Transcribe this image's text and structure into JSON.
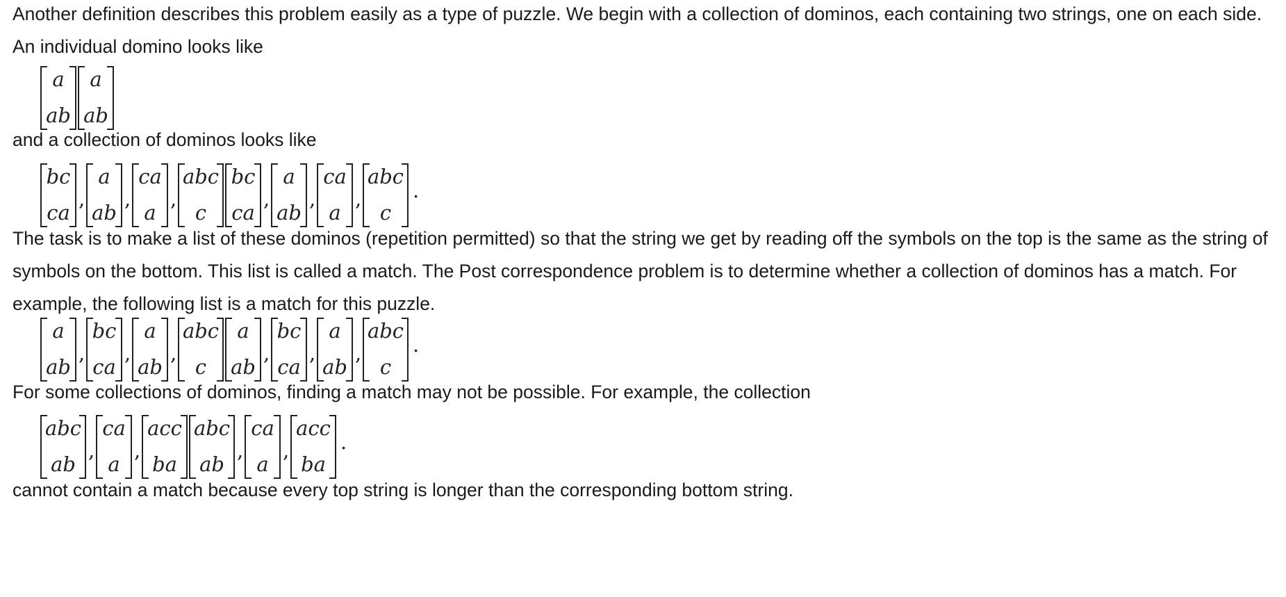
{
  "paragraphs": {
    "intro": "Another definition describes this problem easily as a type of puzzle. We begin with a collection of dominos, each containing two strings, one on each side. An individual domino looks like",
    "collection_intro": "and a collection of dominos looks like",
    "task": "The task is to make a list of these dominos (repetition permitted) so that the string we get by reading off the symbols on the top is the same as the string of symbols on the bottom. This list is called a match. The Post correspondence problem is to determine whether a collection of dominos has a match. For example, the following list is a match for this puzzle.",
    "impossible_intro": "For some collections of dominos, finding a match may not be possible. For example, the collection",
    "conclusion": "cannot contain a match because every top string is longer than the corresponding bottom string."
  },
  "equations": {
    "single_domino": {
      "items": [
        {
          "top": "a",
          "bottom": "ab"
        },
        {
          "top": "a",
          "bottom": "ab"
        }
      ],
      "separators": [
        "",
        ""
      ],
      "end": ""
    },
    "collection": {
      "items": [
        {
          "top": "bc",
          "bottom": "ca"
        },
        {
          "top": "a",
          "bottom": "ab"
        },
        {
          "top": "ca",
          "bottom": "a"
        },
        {
          "top": "abc",
          "bottom": "c"
        },
        {
          "top": "bc",
          "bottom": "ca"
        },
        {
          "top": "a",
          "bottom": "ab"
        },
        {
          "top": "ca",
          "bottom": "a"
        },
        {
          "top": "abc",
          "bottom": "c"
        }
      ],
      "separators": [
        ",",
        ",",
        ",",
        "",
        ",",
        ",",
        ",",
        ""
      ],
      "end": "."
    },
    "match": {
      "items": [
        {
          "top": "a",
          "bottom": "ab"
        },
        {
          "top": "bc",
          "bottom": "ca"
        },
        {
          "top": "a",
          "bottom": "ab"
        },
        {
          "top": "abc",
          "bottom": "c"
        },
        {
          "top": "a",
          "bottom": "ab"
        },
        {
          "top": "bc",
          "bottom": "ca"
        },
        {
          "top": "a",
          "bottom": "ab"
        },
        {
          "top": "abc",
          "bottom": "c"
        }
      ],
      "separators": [
        ",",
        ",",
        ",",
        "",
        ",",
        ",",
        ",",
        ""
      ],
      "end": "."
    },
    "no_match": {
      "items": [
        {
          "top": "abc",
          "bottom": "ab"
        },
        {
          "top": "ca",
          "bottom": "a"
        },
        {
          "top": "acc",
          "bottom": "ba"
        },
        {
          "top": "abc",
          "bottom": "ab"
        },
        {
          "top": "ca",
          "bottom": "a"
        },
        {
          "top": "acc",
          "bottom": "ba"
        }
      ],
      "separators": [
        ",",
        ",",
        "",
        ",",
        ",",
        ""
      ],
      "end": "."
    }
  }
}
